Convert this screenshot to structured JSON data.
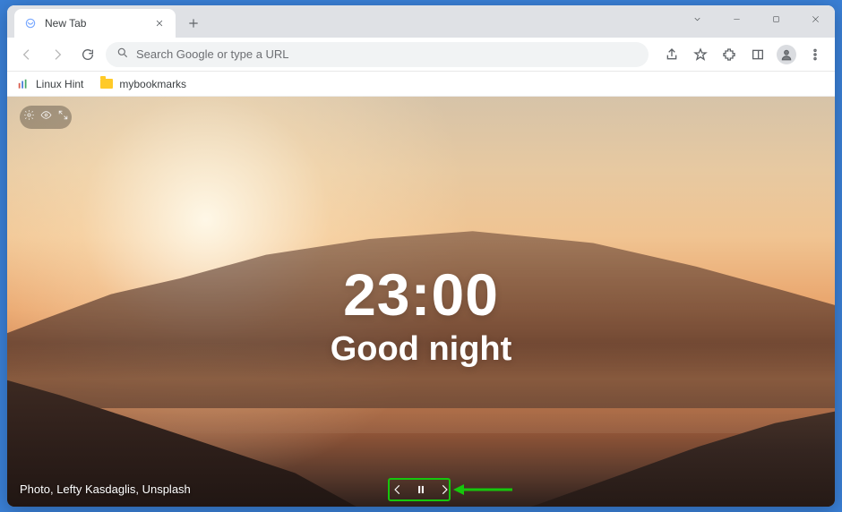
{
  "tab": {
    "title": "New Tab"
  },
  "omnibox": {
    "placeholder": "Search Google or type a URL"
  },
  "bookmarks": [
    {
      "label": "Linux Hint",
      "icon": "site"
    },
    {
      "label": "mybookmarks",
      "icon": "folder"
    }
  ],
  "clock": {
    "time": "23:00",
    "greeting": "Good night"
  },
  "photo_credit": "Photo, Lefty Kasdaglis, Unsplash",
  "colors": {
    "accent_green": "#16c60c"
  }
}
